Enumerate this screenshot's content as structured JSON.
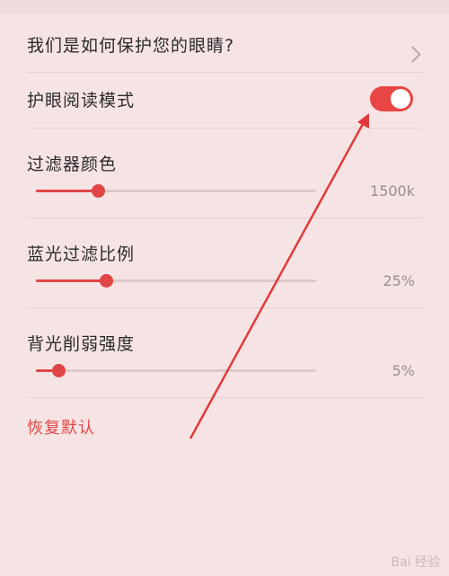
{
  "rows": {
    "protect_link": "我们是如何保护您的眼睛?",
    "eye_mode_label": "护眼阅读模式",
    "eye_mode_on": true
  },
  "sliders": [
    {
      "label": "过滤器颜色",
      "value_text": "1500k",
      "fraction": 0.22
    },
    {
      "label": "蓝光过滤比例",
      "value_text": "25%",
      "fraction": 0.25
    },
    {
      "label": "背光削弱强度",
      "value_text": "5%",
      "fraction": 0.08
    }
  ],
  "reset_label": "恢复默认",
  "watermark": "Bai 经验",
  "colors": {
    "accent": "#e84545",
    "background": "#f6e4e4"
  }
}
